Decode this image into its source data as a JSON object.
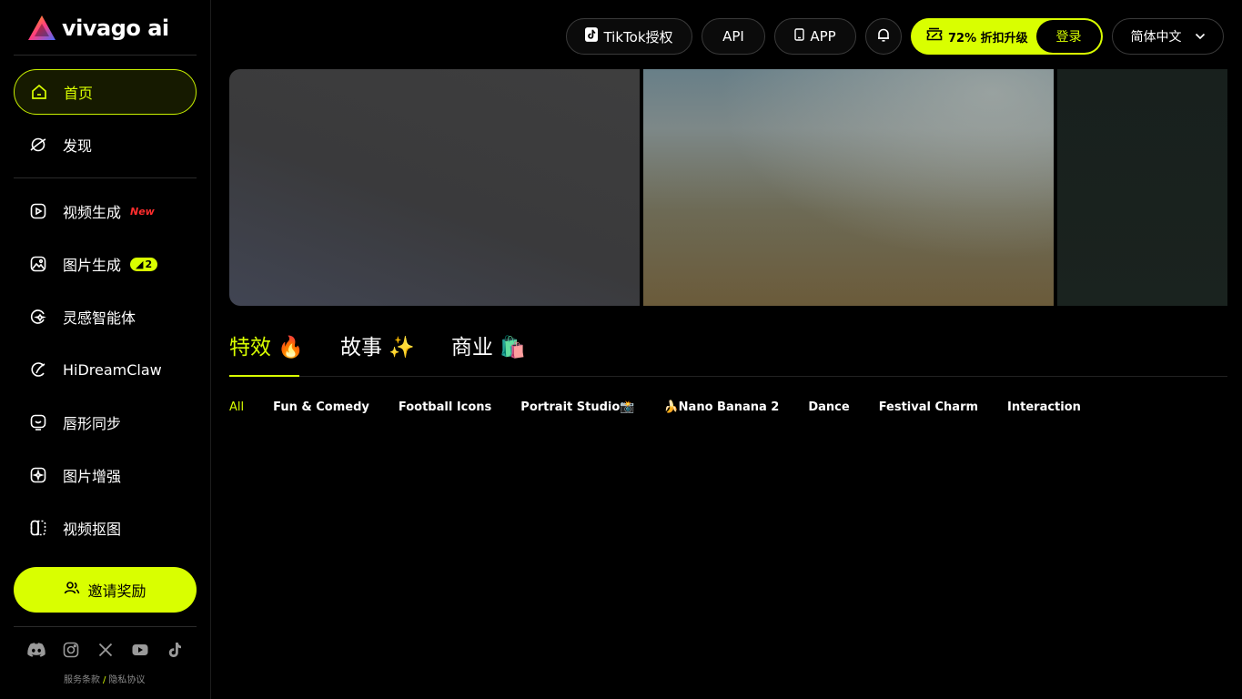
{
  "brand": {
    "name": "vivago ai"
  },
  "sidebar": {
    "items": [
      {
        "label": "首页",
        "icon": "home-icon",
        "active": true
      },
      {
        "label": "发现",
        "icon": "discover-icon"
      },
      {
        "label": "视频生成",
        "icon": "video-generate-icon",
        "badge": "New"
      },
      {
        "label": "图片生成",
        "icon": "image-generate-icon",
        "badge": "2"
      },
      {
        "label": "灵感智能体",
        "icon": "inspiration-agent-icon"
      },
      {
        "label": "HiDreamClaw",
        "icon": "claw-icon"
      },
      {
        "label": "唇形同步",
        "icon": "lip-sync-icon"
      },
      {
        "label": "图片增强",
        "icon": "image-enhance-icon"
      },
      {
        "label": "视频抠图",
        "icon": "video-matting-icon"
      }
    ],
    "invite_label": "邀请奖励",
    "socials": [
      "discord-icon",
      "instagram-icon",
      "x-icon",
      "youtube-icon",
      "tiktok-icon"
    ],
    "terms": "服务条款",
    "separator": "/",
    "privacy": "隐私协议"
  },
  "header": {
    "tiktok": "TikTok授权",
    "api": "API",
    "app": "APP",
    "upgrade": "72% 折扣升级",
    "login": "登录",
    "language": "简体中文"
  },
  "tabs": [
    {
      "label": "特效 🔥",
      "active": true
    },
    {
      "label": "故事 ✨"
    },
    {
      "label": "商业 🛍️"
    }
  ],
  "filters": [
    {
      "label": "All",
      "active": true
    },
    {
      "label": "Fun & Comedy"
    },
    {
      "label": "Football Icons"
    },
    {
      "label": "Portrait Studio📸"
    },
    {
      "label": "🍌Nano Banana 2"
    },
    {
      "label": "Dance"
    },
    {
      "label": "Festival Charm"
    },
    {
      "label": "Interaction"
    }
  ],
  "colors": {
    "accent": "#d9ff00",
    "new_badge": "#ff2d2d",
    "background": "#000000"
  }
}
